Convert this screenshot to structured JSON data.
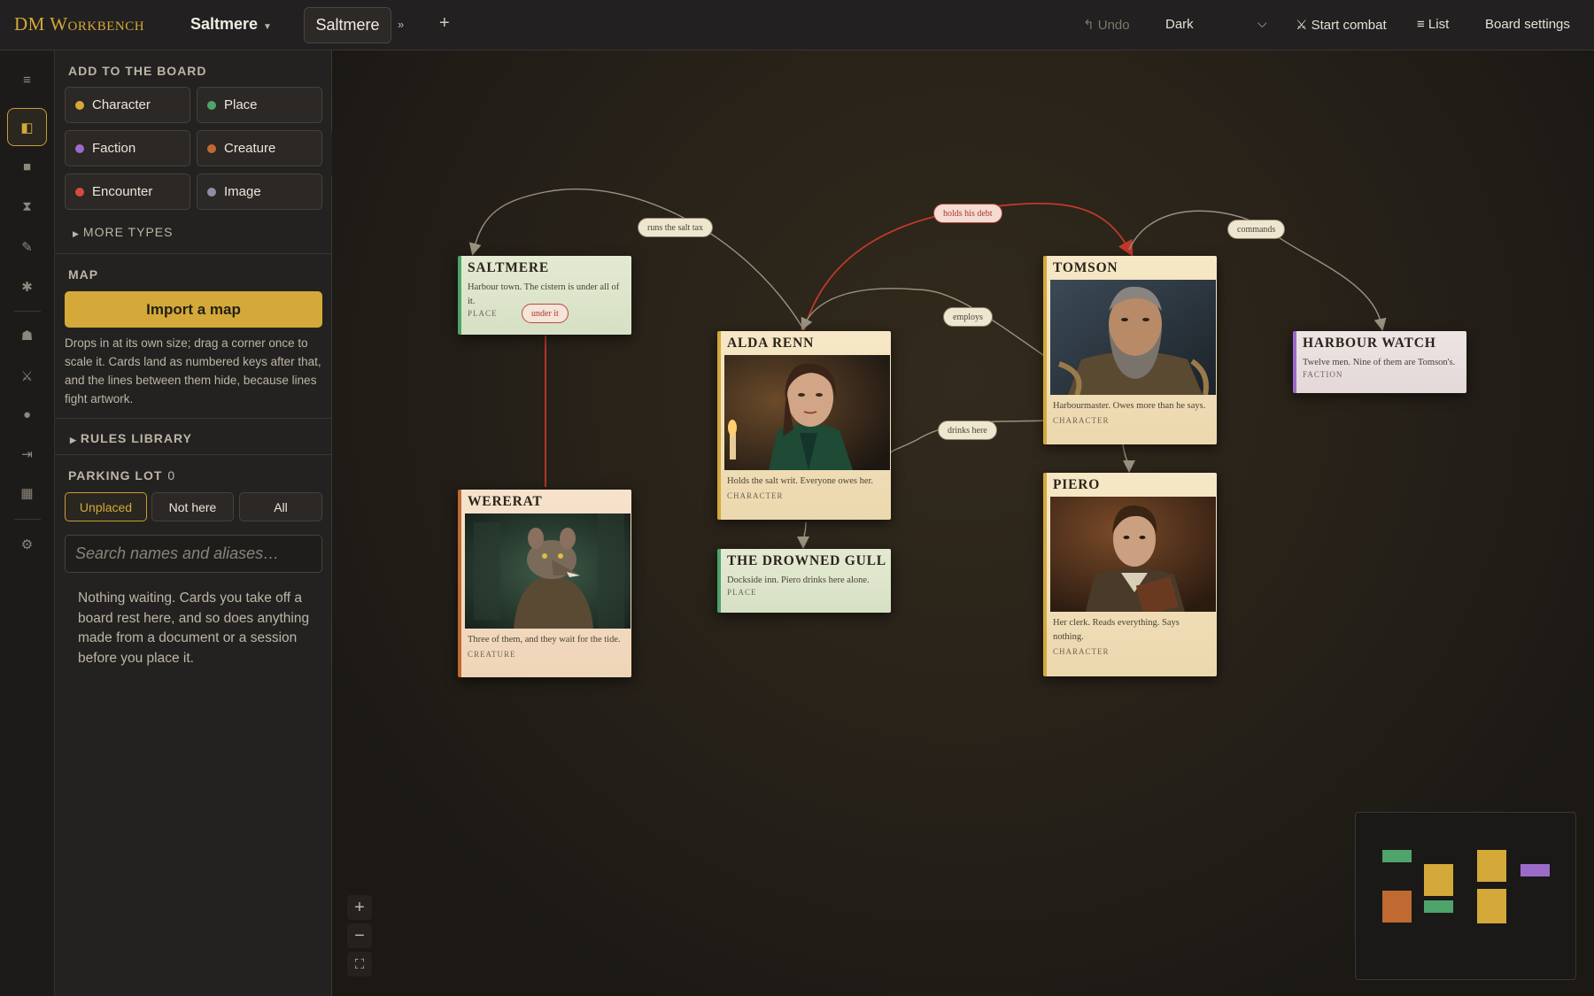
{
  "app": {
    "brand": "DM Workbench",
    "board_name": "Saltmere"
  },
  "tabs": {
    "active": "Saltmere",
    "more": "»",
    "add": "+"
  },
  "toolbar": {
    "undo": "↰ Undo",
    "theme": "Dark",
    "theme_caret": "⌵",
    "start_combat": "⚔ Start combat",
    "list": "≡ List",
    "board_settings": "Board settings"
  },
  "rail": {
    "icons": [
      "menu-icon",
      "panel-icon",
      "square-icon",
      "hourglass-icon",
      "pen-icon",
      "sparkle-icon",
      "bell-icon",
      "swords-icon",
      "dot-icon",
      "import-icon",
      "grid-icon",
      "gear-icon"
    ]
  },
  "panel": {
    "add_title": "ADD TO THE BOARD",
    "add_buttons": [
      {
        "label": "Character",
        "color": "#d4a93a"
      },
      {
        "label": "Place",
        "color": "#4ea46a"
      },
      {
        "label": "Faction",
        "color": "#9b6bc9"
      },
      {
        "label": "Creature",
        "color": "#c06a32"
      },
      {
        "label": "Encounter",
        "color": "#d64a3f"
      },
      {
        "label": "Image",
        "color": "#8e8ea6"
      }
    ],
    "more_types": "MORE TYPES",
    "map_title": "MAP",
    "import_map": "Import a map",
    "map_desc": "Drops in at its own size; drag a corner once to scale it. Cards land as numbered keys after that, and the lines between them hide, because lines fight artwork.",
    "rules_library": "RULES LIBRARY",
    "parking_title": "PARKING LOT",
    "parking_count": "0",
    "filters": [
      "Unplaced",
      "Not here",
      "All"
    ],
    "search_placeholder": "Search names and aliases…",
    "empty_msg": "Nothing waiting. Cards you take off a board rest here, and so does anything made from a document or a session before you place it.",
    "collapse": "«"
  },
  "cards": {
    "saltmere": {
      "name": "SALTMERE",
      "desc": "Harbour town. The cistern is under all of it.",
      "type": "PLACE",
      "tag": "under it"
    },
    "alda": {
      "name": "ALDA RENN",
      "desc": "Holds the salt writ. Everyone owes her.",
      "type": "CHARACTER"
    },
    "tomson": {
      "name": "TOMSON",
      "desc": "Harbourmaster. Owes more than he says.",
      "type": "CHARACTER"
    },
    "harbour": {
      "name": "HARBOUR WATCH",
      "desc": "Twelve men. Nine of them are Tomson's.",
      "type": "FACTION"
    },
    "wererat": {
      "name": "WERERAT",
      "desc": "Three of them, and they wait for the tide.",
      "type": "CREATURE"
    },
    "gull": {
      "name": "THE DROWNED GULL",
      "desc": "Dockside inn. Piero drinks here alone.",
      "type": "PLACE"
    },
    "piero": {
      "name": "PIERO",
      "desc": "Her clerk. Reads everything. Says nothing.",
      "type": "CHARACTER"
    }
  },
  "edges": {
    "runs": "runs the salt tax",
    "debt": "holds his debt",
    "commands": "commands",
    "employs": "employs",
    "drinks": "drinks here"
  },
  "zoom": {
    "in": "+",
    "out": "−",
    "fit": "⛶"
  }
}
